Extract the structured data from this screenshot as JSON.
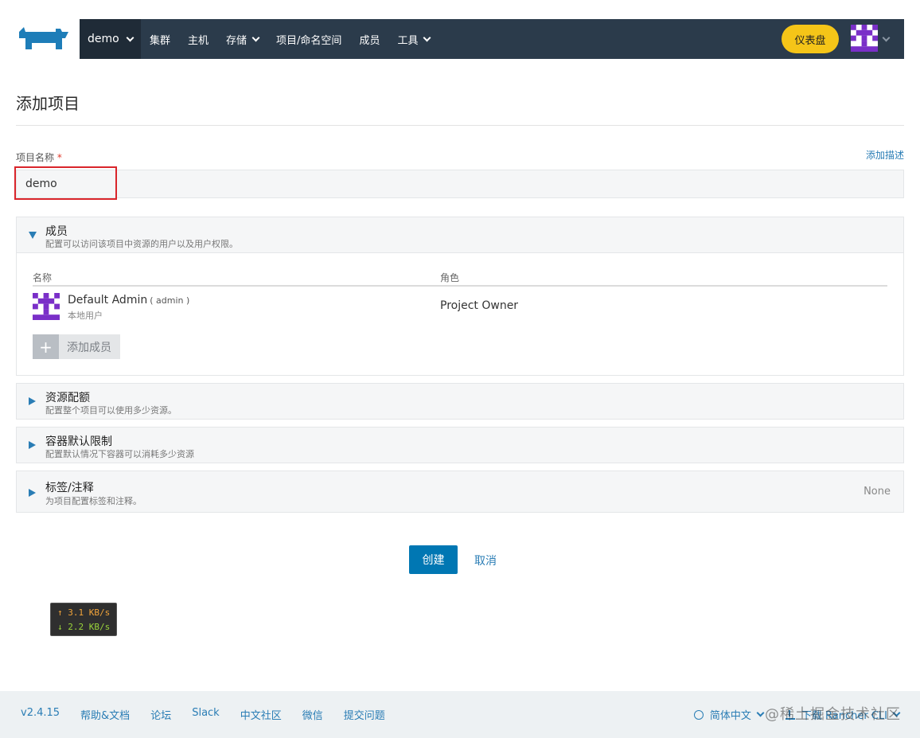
{
  "header": {
    "scope": "demo",
    "nav": [
      "集群",
      "主机",
      "存储",
      "项目/命名空间",
      "成员",
      "工具"
    ],
    "dashboard_label": "仪表盘"
  },
  "page": {
    "title": "添加项目",
    "name_label": "项目名称",
    "required_mark": "*",
    "add_description": "添加描述",
    "name_value": "demo"
  },
  "members": {
    "title": "成员",
    "subtitle": "配置可以访问该项目中资源的用户以及用户权限。",
    "col_name": "名称",
    "col_role": "角色",
    "rows": [
      {
        "name": "Default Admin",
        "login": "( admin )",
        "type": "本地用户",
        "role": "Project Owner"
      }
    ],
    "add_label": "添加成员",
    "add_icon": "plus-icon"
  },
  "resource_quota": {
    "title": "资源配额",
    "subtitle": "配置整个项目可以使用多少资源。"
  },
  "container_limits": {
    "title": "容器默认限制",
    "subtitle": "配置默认情况下容器可以消耗多少资源"
  },
  "labels": {
    "title": "标签/注释",
    "subtitle": "为项目配置标签和注释。",
    "value": "None"
  },
  "actions": {
    "create": "创建",
    "cancel": "取消"
  },
  "netspeed": {
    "up": "↑ 3.1 KB/s",
    "down": "↓ 2.2 KB/s"
  },
  "footer": {
    "version": "v2.4.15",
    "links": [
      "帮助&文档",
      "论坛",
      "Slack",
      "中文社区",
      "微信",
      "提交问题"
    ],
    "language": "简体中文",
    "download": "下载 Rancher CLI",
    "watermark": "@稀土掘金技术社区"
  },
  "colors": {
    "topbar": "#2b3b4b",
    "accent": "#0077b3",
    "dashboard": "#f5c518",
    "highlight": "#d9252b"
  }
}
